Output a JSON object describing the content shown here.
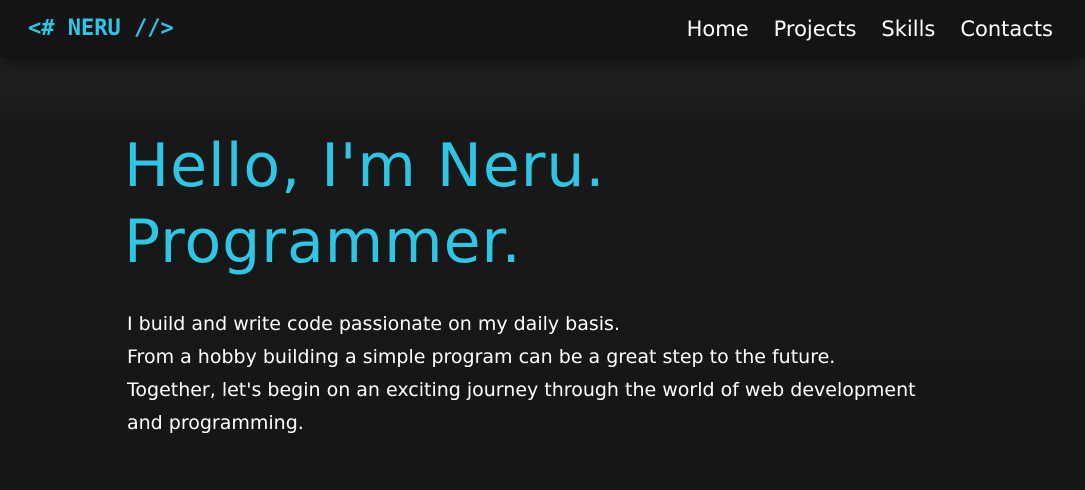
{
  "navbar": {
    "logo": "<# NERU //>",
    "links": [
      {
        "label": "Home"
      },
      {
        "label": "Projects"
      },
      {
        "label": "Skills"
      },
      {
        "label": "Contacts"
      }
    ]
  },
  "hero": {
    "title_line1": "Hello, I'm Neru.",
    "title_line2": "Programmer.",
    "description": [
      "I build and write code passionate on my daily basis.",
      "From a hobby building a simple program can be a great step to the future.",
      "Together, let's begin on an exciting journey through the world of web development",
      "and programming."
    ]
  },
  "colors": {
    "accent": "#2fc6e6",
    "background": "#161616",
    "navbar_background": "#141414",
    "text": "#ffffff"
  }
}
